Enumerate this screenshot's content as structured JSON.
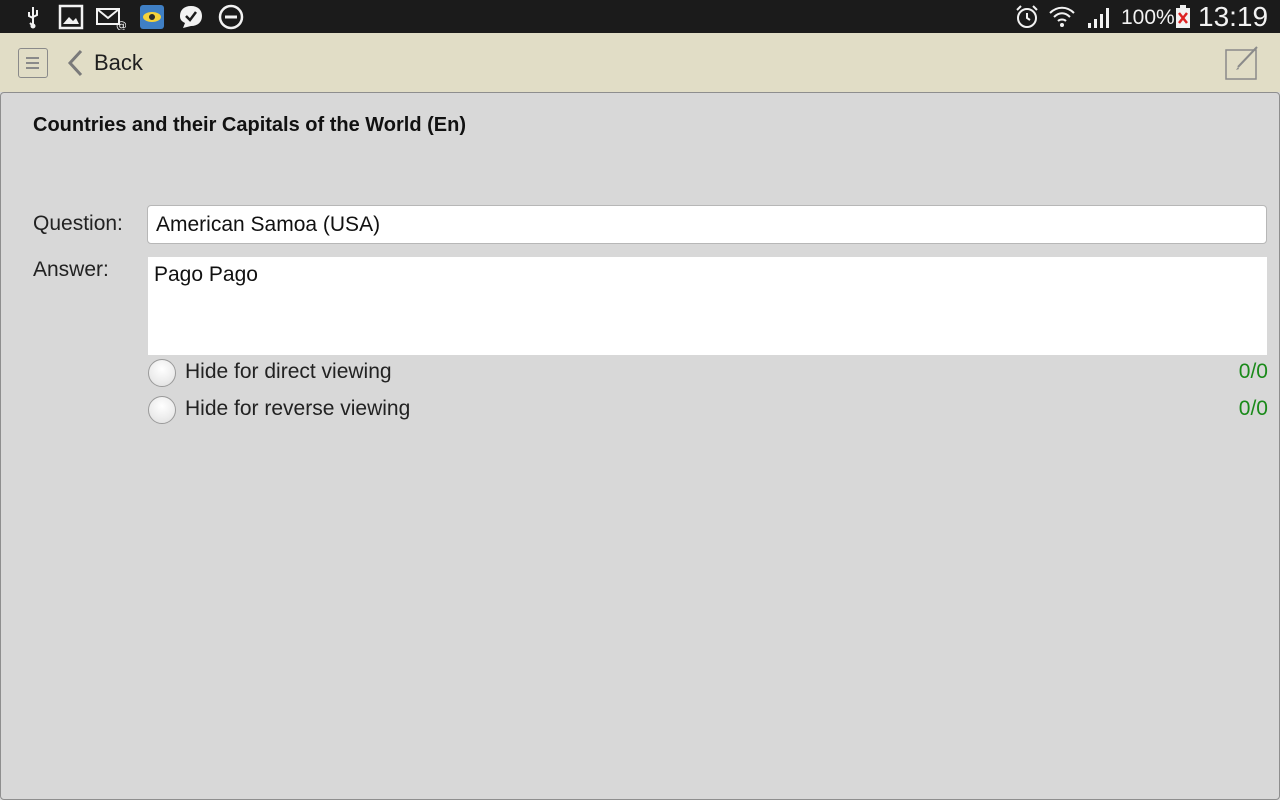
{
  "status_bar": {
    "battery": "100%",
    "time": "13:19",
    "icons": [
      "usb-icon",
      "image-icon",
      "email-icon",
      "app-eye-icon",
      "check-bubble-icon",
      "do-not-disturb-icon",
      "alarm-icon",
      "wifi-icon",
      "signal-icon",
      "battery-icon"
    ]
  },
  "action_bar": {
    "back_label": "Back",
    "icons": [
      "menu-icon",
      "chevron-left-icon",
      "edit-icon"
    ]
  },
  "card": {
    "deck_title": "Countries and their Capitals of the World (En)",
    "question_label": "Question:",
    "question_value": "American Samoa (USA)",
    "answer_label": "Answer:",
    "answer_value": "Pago Pago",
    "options": [
      {
        "label": "Hide for direct viewing",
        "count": "0/0",
        "checked": false
      },
      {
        "label": "Hide for reverse viewing",
        "count": "0/0",
        "checked": false
      }
    ]
  },
  "colors": {
    "status_bar_bg": "#1b1b1b",
    "action_bar_bg": "#e1ddc6",
    "content_bg": "#d8d8d8",
    "count_green": "#1a8a1a"
  }
}
